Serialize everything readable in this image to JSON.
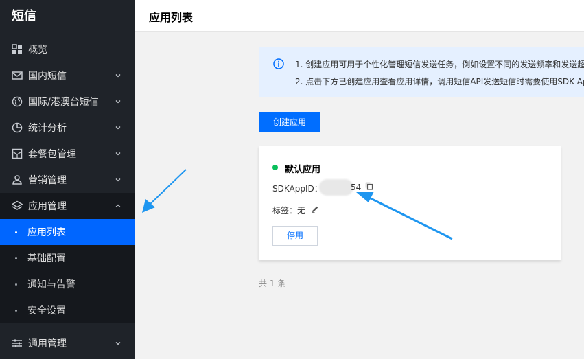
{
  "sidebar": {
    "brand": "短信",
    "items": [
      {
        "label": "概览",
        "icon": "dashboard-icon"
      },
      {
        "label": "国内短信",
        "icon": "mail-icon"
      },
      {
        "label": "国际/港澳台短信",
        "icon": "globe-icon"
      },
      {
        "label": "统计分析",
        "icon": "pie-chart-icon"
      },
      {
        "label": "套餐包管理",
        "icon": "package-icon"
      },
      {
        "label": "营销管理",
        "icon": "user-group-icon"
      },
      {
        "label": "应用管理",
        "icon": "layers-icon"
      },
      {
        "label": "通用管理",
        "icon": "sliders-icon"
      }
    ],
    "sub_items": [
      {
        "label": "应用列表"
      },
      {
        "label": "基础配置"
      },
      {
        "label": "通知与告警"
      },
      {
        "label": "安全设置"
      }
    ]
  },
  "header": {
    "title": "应用列表"
  },
  "notice": {
    "icon": "info-icon",
    "line1": "1. 创建应用可用于个性化管理短信发送任务，例如设置不同的发送频率和发送超",
    "line2": "2. 点击下方已创建应用查看应用详情，调用短信API发送短信时需要使用SDK Ap"
  },
  "create_button": "创建应用",
  "card": {
    "app_name": "默认应用",
    "sdk_label": "SDKAppID：",
    "sdk_suffix": "54",
    "tag_label": "标签：",
    "tag_value": "无",
    "disable_button": "停用"
  },
  "total": "共 1 条",
  "colors": {
    "sidebar_bg": "#1f2329",
    "active_bg": "#0066ff",
    "primary": "#006eff",
    "status_green": "#0abf5b",
    "notice_bg": "#e5f0ff",
    "annotation_arrow": "#1e96f0"
  }
}
